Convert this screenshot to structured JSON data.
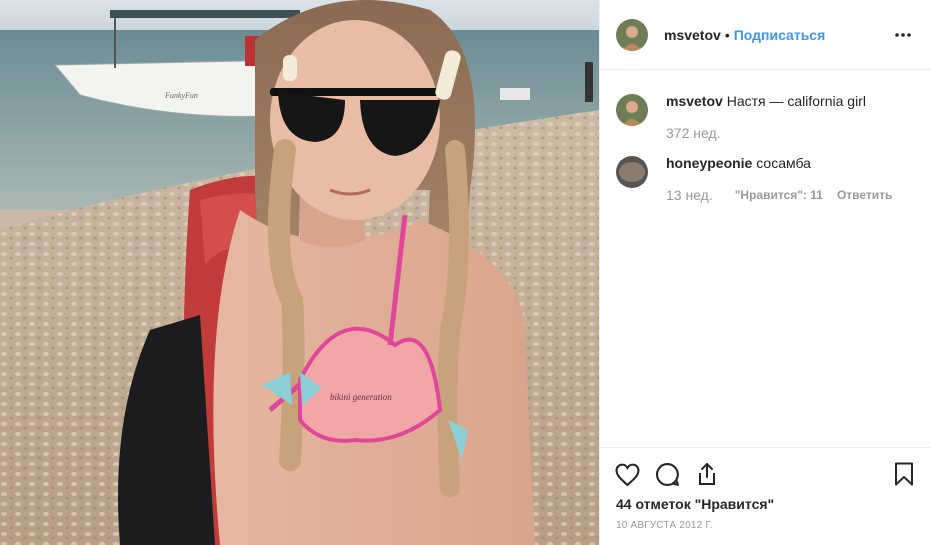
{
  "header": {
    "username": "msvetov",
    "separator": "•",
    "follow_label": "Подписаться",
    "more_icon": "ellipsis-icon"
  },
  "caption": {
    "username": "msvetov",
    "text": "Настя — california girl",
    "time": "372 нед."
  },
  "comments": [
    {
      "username": "honeypeonie",
      "text": "сосамба",
      "time": "13 нед.",
      "likes_label": "\"Нравится\": 11",
      "reply_label": "Ответить"
    }
  ],
  "actions": {
    "like_icon": "heart-icon",
    "comment_icon": "comment-icon",
    "share_icon": "share-icon",
    "save_icon": "bookmark-icon"
  },
  "likes_text": "44 отметок \"Нравится\"",
  "date_text": "10 АВГУСТА 2012 Г.",
  "photo": {
    "bikini_print": "bikini generation",
    "boat_name": "FunkyFun"
  }
}
